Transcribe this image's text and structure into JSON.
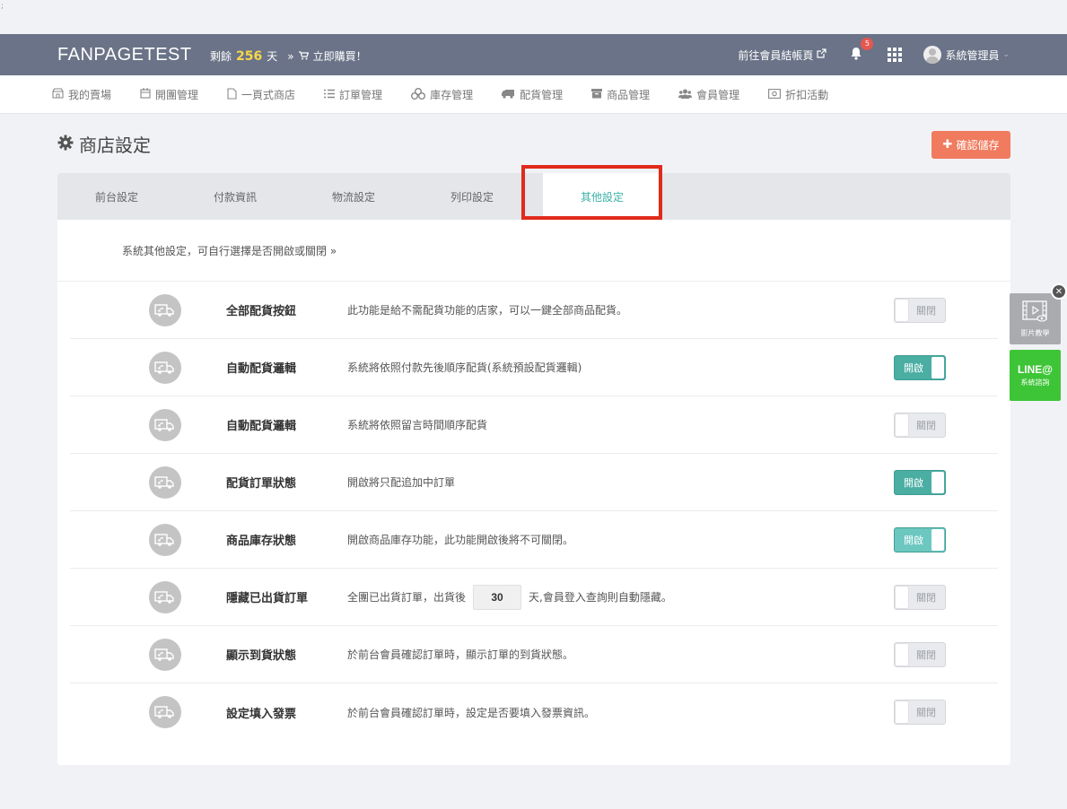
{
  "corner_mark": ";",
  "header": {
    "brand": "FANPAGETEST",
    "remain_prefix": "剩餘",
    "remain_days": "256",
    "remain_suffix": "天",
    "buy_arrow": "»",
    "buy_label": "立即購買！",
    "checkout_link": "前往會員結帳頁",
    "notification_count": "5",
    "user_name": "系統管理員"
  },
  "nav": {
    "items": [
      {
        "label": "我的賣場",
        "icon": "store-icon"
      },
      {
        "label": "開團管理",
        "icon": "calendar-icon"
      },
      {
        "label": "一頁式商店",
        "icon": "page-icon"
      },
      {
        "label": "訂單管理",
        "icon": "list-icon"
      },
      {
        "label": "庫存管理",
        "icon": "cubes-icon"
      },
      {
        "label": "配貨管理",
        "icon": "truck-icon"
      },
      {
        "label": "商品管理",
        "icon": "archive-icon"
      },
      {
        "label": "會員管理",
        "icon": "users-icon"
      },
      {
        "label": "折扣活動",
        "icon": "money-icon"
      }
    ]
  },
  "page": {
    "title": "商店設定",
    "save_label": "確認儲存"
  },
  "tabs": [
    {
      "label": "前台設定",
      "active": false
    },
    {
      "label": "付款資訊",
      "active": false
    },
    {
      "label": "物流設定",
      "active": false
    },
    {
      "label": "列印設定",
      "active": false
    },
    {
      "label": "其他設定",
      "active": true
    }
  ],
  "intro": "系統其他設定，可自行選擇是否開啟或關閉 »",
  "settings": [
    {
      "title": "全部配貨按鈕",
      "desc": "此功能是給不需配貨功能的店家，可以一鍵全部商品配貨。",
      "state": "關閉"
    },
    {
      "title": "自動配貨邏輯",
      "desc": "系統將依照付款先後順序配貨(系統預設配貨邏輯)",
      "state": "開啟"
    },
    {
      "title": "自動配貨邏輯",
      "desc": "系統將依照留言時間順序配貨",
      "state": "關閉"
    },
    {
      "title": "配貨訂單狀態",
      "desc": "開啟將只配追加中訂單",
      "state": "開啟"
    },
    {
      "title": "商品庫存狀態",
      "desc": "開啟商品庫存功能，此功能開啟後將不可關閉。",
      "state": "開啟"
    },
    {
      "title": "隱藏已出貨訂單",
      "desc_before": "全團已出貨訂單，出貨後",
      "input_value": "30",
      "desc_after": "天,會員登入查詢則自動隱藏。",
      "state": "關閉"
    },
    {
      "title": "顯示到貨狀態",
      "desc": "於前台會員確認訂單時，顯示訂單的到貨狀態。",
      "state": "關閉"
    },
    {
      "title": "設定填入發票",
      "desc": "於前台會員確認訂單時，設定是否要填入發票資訊。",
      "state": "關閉"
    }
  ],
  "side": {
    "video_label": "影片教學",
    "line_label": "LINE@",
    "line_sub": "系統諮詢"
  },
  "colors": {
    "topbar": "#6a7387",
    "accent": "#3bb1a8",
    "save_button": "#f07b5e",
    "toggle_on": "#4aaea3",
    "highlight": "#e12a1b",
    "line_green": "#3ec537"
  }
}
